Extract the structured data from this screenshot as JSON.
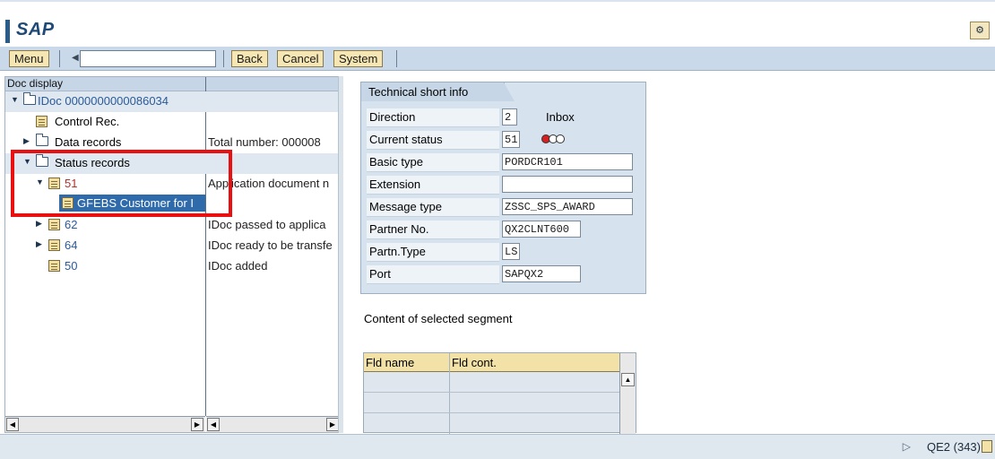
{
  "app": {
    "title": "SAP",
    "help_icon": "customize-layout-icon"
  },
  "toolbar": {
    "menu_label": "Menu",
    "command_field_value": "",
    "back_label": "Back",
    "cancel_label": "Cancel",
    "system_label": "System"
  },
  "tree": {
    "header": "Doc display",
    "rows": [
      {
        "label": "IDoc 0000000000086034",
        "desc": ""
      },
      {
        "label": "Control Rec.",
        "desc": ""
      },
      {
        "label": "Data records",
        "desc": "Total number: 000008"
      },
      {
        "label": "Status records",
        "desc": ""
      },
      {
        "label": "51",
        "desc": "Application document n"
      },
      {
        "label": "GFEBS Customer for I",
        "desc": ""
      },
      {
        "label": "62",
        "desc": "IDoc passed to applica"
      },
      {
        "label": "64",
        "desc": "IDoc ready to be transfe"
      },
      {
        "label": "50",
        "desc": "IDoc added"
      }
    ]
  },
  "tech": {
    "tab_title": "Technical short info",
    "fields": [
      {
        "label": "Direction",
        "value": "2",
        "extra": "Inbox"
      },
      {
        "label": "Current status",
        "value": "51",
        "extra": ""
      },
      {
        "label": "Basic type",
        "value": "PORDCR101",
        "extra": ""
      },
      {
        "label": "Extension",
        "value": "",
        "extra": ""
      },
      {
        "label": "Message type",
        "value": "ZSSC_SPS_AWARD",
        "extra": ""
      },
      {
        "label": "Partner No.",
        "value": "QX2CLNT600",
        "extra": ""
      },
      {
        "label": "Partn.Type",
        "value": "LS",
        "extra": ""
      },
      {
        "label": "Port",
        "value": "SAPQX2",
        "extra": ""
      }
    ],
    "status_colors": [
      "#d42020",
      "#ffffff",
      "#ffffff"
    ]
  },
  "segment": {
    "title": "Content of selected segment",
    "columns": [
      "Fld name",
      "Fld cont."
    ]
  },
  "status_bar": {
    "system": "QE2 (343)"
  },
  "colors": {
    "annotation": "#e81010",
    "selection": "#2f6aaa"
  }
}
